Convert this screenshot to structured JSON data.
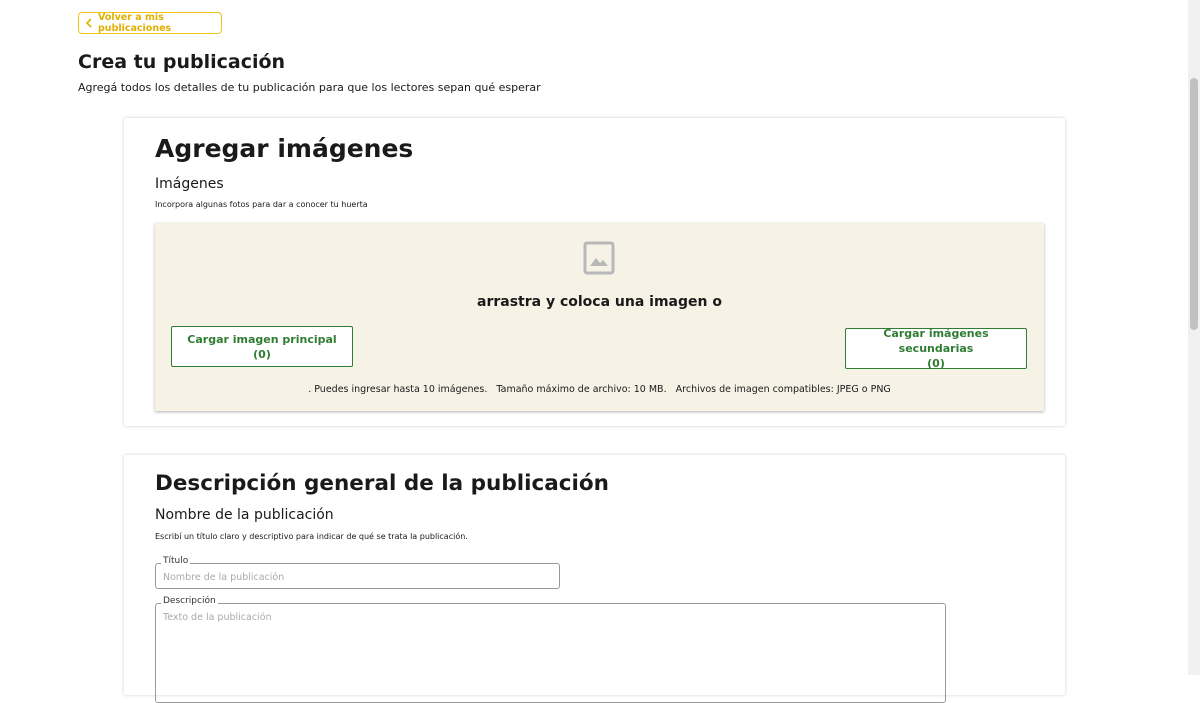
{
  "header": {
    "back_label": "Volver a mis publicaciones",
    "title": "Crea tu publicación",
    "subtitle": "Agregá todos los detalles de tu publicación para que los lectores sepan qué esperar"
  },
  "images_section": {
    "title": "Agregar imágenes",
    "label": "Imágenes",
    "help": "Incorpora algunas fotos para dar a conocer tu huerta",
    "drop_text": "arrastra y coloca una imagen o",
    "main_button": {
      "line1": "Cargar imagen principal",
      "line2": "(0)"
    },
    "secondary_button": {
      "line1": "Cargar imágenes secundarias",
      "line2": "(0)"
    },
    "info": ". Puedes ingresar hasta 10 imágenes.   Tamaño máximo de archivo: 10 MB.   Archivos de imagen compatibles: JPEG o PNG"
  },
  "overview_section": {
    "title": "Descripción general de la publicación",
    "label": "Nombre de la publicación",
    "help": "Escribí un título claro y descriptivo para indicar de qué se trata la publicación.",
    "title_field": {
      "legend": "Título",
      "placeholder": "Nombre de la publicación",
      "value": ""
    },
    "description_field": {
      "legend": "Descripción",
      "placeholder": "Texto de la publicación",
      "value": ""
    }
  },
  "icons": {
    "back": "chevron-left-icon",
    "image": "image-placeholder-icon"
  },
  "colors": {
    "accent_yellow": "#f0c419",
    "accent_green": "#2e7d32",
    "dropzone_bg": "#f6f2e6"
  }
}
